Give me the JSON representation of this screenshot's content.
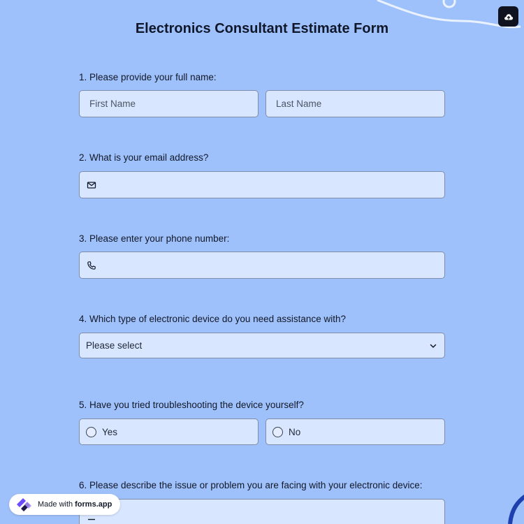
{
  "form": {
    "title": "Electronics Consultant Estimate Form"
  },
  "questions": {
    "q1": {
      "label": "1.  Please provide your full name:",
      "first_placeholder": "First Name",
      "last_placeholder": "Last Name"
    },
    "q2": {
      "label": "2. What is your email address?",
      "placeholder": ""
    },
    "q3": {
      "label": "3. Please enter your phone number:",
      "placeholder": ""
    },
    "q4": {
      "label": "4. Which type of electronic device do you need assistance with?",
      "selected": "Please select"
    },
    "q5": {
      "label": "5. Have you tried troubleshooting the device yourself?",
      "options": [
        "Yes",
        "No"
      ]
    },
    "q6": {
      "label": "6. Please describe the issue or problem you are facing with your electronic device:"
    }
  },
  "badge": {
    "prefix": "Made with",
    "brand": "forms.app"
  },
  "icons": {
    "upload": "cloud-upload-icon",
    "email": "envelope-icon",
    "phone": "phone-icon",
    "select": "chevron-down-icon",
    "logo": "forms-app-logo-icon"
  },
  "colors": {
    "background": "#9fc1fb",
    "field": "#d9e6ff",
    "dark": "#0f1320",
    "accent": "#6d4cff"
  }
}
